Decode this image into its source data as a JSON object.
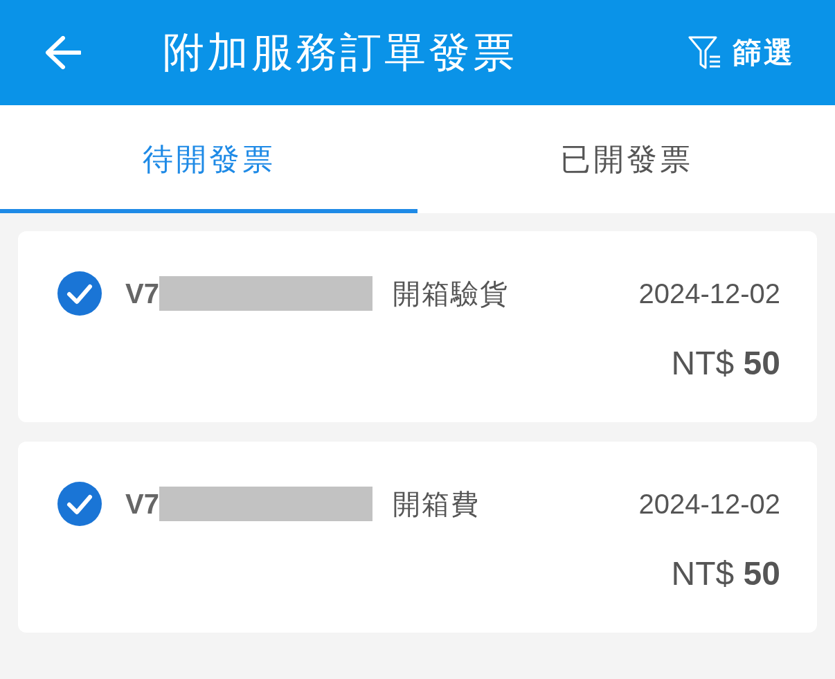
{
  "header": {
    "title": "附加服務訂單發票",
    "filter_label": "篩選"
  },
  "tabs": [
    {
      "label": "待開發票",
      "selected": true
    },
    {
      "label": "已開發票",
      "selected": false
    }
  ],
  "invoices": [
    {
      "checked": true,
      "order_number": "V7",
      "redacted": true,
      "service": "開箱驗貨",
      "date": "2024-12-02",
      "amount": "NT$ **50**"
    },
    {
      "checked": true,
      "order_number": "V7",
      "redacted": true,
      "service": "開箱費",
      "date": "2024-12-02",
      "amount": "NT$ **50**"
    }
  ]
}
